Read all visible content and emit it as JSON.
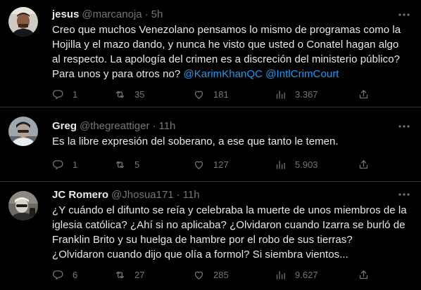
{
  "tweets": [
    {
      "name": "jesus",
      "handle": "@marcanoja",
      "separator": "·",
      "time": "5h",
      "text_lines": [
        "Creo que muchos Venezolano pensamos lo mismo de programas como la",
        "Hojilla y el mazo dando, y nunca he visto que usted o Conatel hagan algo",
        "al respecto. La apología del crimen es a discreción del ministerio público?",
        "Para unos y para otros no?"
      ],
      "mentions": [
        "@KarimKhanQC",
        "@IntlCrimCourt"
      ],
      "replies": "1",
      "retweets": "35",
      "likes": "181",
      "views": "3.367"
    },
    {
      "name": "Greg",
      "handle": "@thegreattiger",
      "separator": "·",
      "time": "11h",
      "text_lines": [
        "Es la libre expresión del soberano, a ese que tanto le temen."
      ],
      "replies": "1",
      "retweets": "5",
      "likes": "127",
      "views": "5.903"
    },
    {
      "name": "JC Romero",
      "handle": "@Jhosua171",
      "separator": "·",
      "time": "11h",
      "text_lines": [
        "¿Y cuándo el difunto se reía y celebraba la muerte de unos miembros de la",
        "iglesia católica? ¿Ahí si no aplicaba? ¿Olvidaron cuando Izarra se burló de",
        "Franklin Brito y su huelga de hambre por el robo de sus tierras?",
        "¿Olvidaron cuando dijo que olía a formol? Si siembra vientos..."
      ],
      "replies": "6",
      "retweets": "27",
      "likes": "285",
      "views": "9.627"
    }
  ],
  "icons": {
    "more": "more-icon",
    "reply": "reply-icon",
    "retweet": "retweet-icon",
    "like": "heart-icon",
    "views": "views-icon",
    "share": "share-icon"
  },
  "colors": {
    "background": "#000000",
    "text": "#e7e9ea",
    "secondary": "#71767b",
    "link": "#1d9bf0",
    "divider": "#2f3336"
  }
}
